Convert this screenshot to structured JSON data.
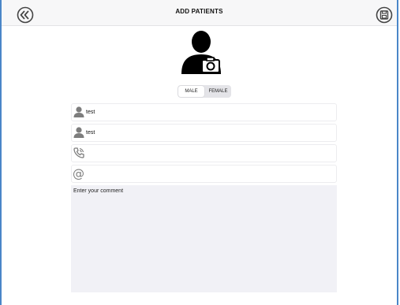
{
  "navbar": {
    "title": "ADD PATIENTS",
    "back_icon": "chevron-double-left-icon",
    "save_icon": "floppy-disk-icon"
  },
  "avatar": {
    "icon": "person-camera-icon"
  },
  "gender": {
    "options": [
      "MALE",
      "FEMALE"
    ],
    "selected": "MALE"
  },
  "form": {
    "first_name": {
      "value": "test",
      "icon": "person-icon"
    },
    "last_name": {
      "value": "test",
      "icon": "person-icon"
    },
    "phone": {
      "value": "",
      "icon": "phone-icon"
    },
    "email": {
      "value": "",
      "icon": "at-sign-icon"
    },
    "comment": {
      "placeholder": "Enter your comment"
    }
  },
  "colors": {
    "frame": "#4a86c8",
    "navbar_bg": "#f7f7f8",
    "comment_bg": "#f1f1f6",
    "icon_gray": "#7d7d7d"
  }
}
